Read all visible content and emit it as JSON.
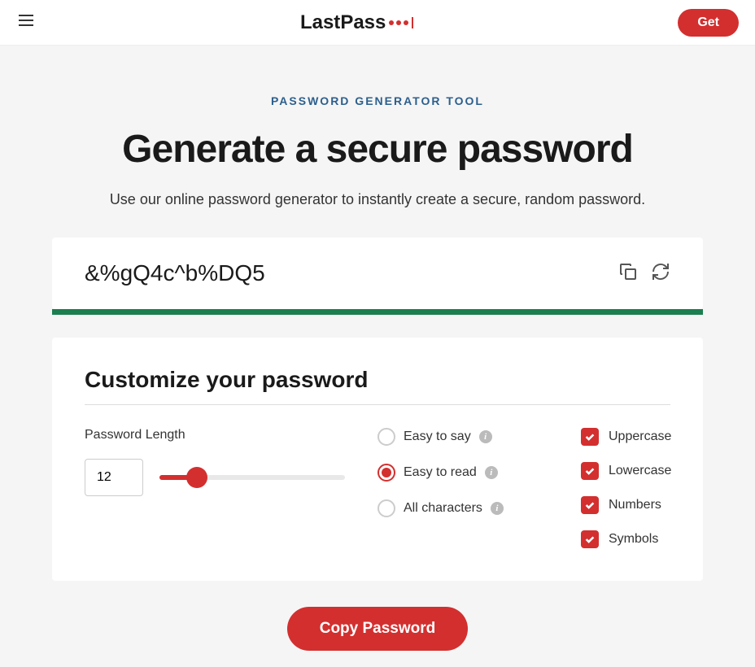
{
  "header": {
    "logo_text_1": "Last",
    "logo_text_2": "Pass",
    "get_label": "Get"
  },
  "eyebrow": "PASSWORD GENERATOR TOOL",
  "title": "Generate a secure password",
  "subtitle": "Use our online password generator to instantly create a secure, random password.",
  "password": "&%gQ4c^b%DQ5",
  "customize_title": "Customize your password",
  "length": {
    "label": "Password Length",
    "value": "12"
  },
  "radios": {
    "easy_say": "Easy to say",
    "easy_read": "Easy to read",
    "all_chars": "All characters",
    "selected": "easy_read"
  },
  "checks": {
    "uppercase": "Uppercase",
    "lowercase": "Lowercase",
    "numbers": "Numbers",
    "symbols": "Symbols"
  },
  "copy_button": "Copy Password"
}
